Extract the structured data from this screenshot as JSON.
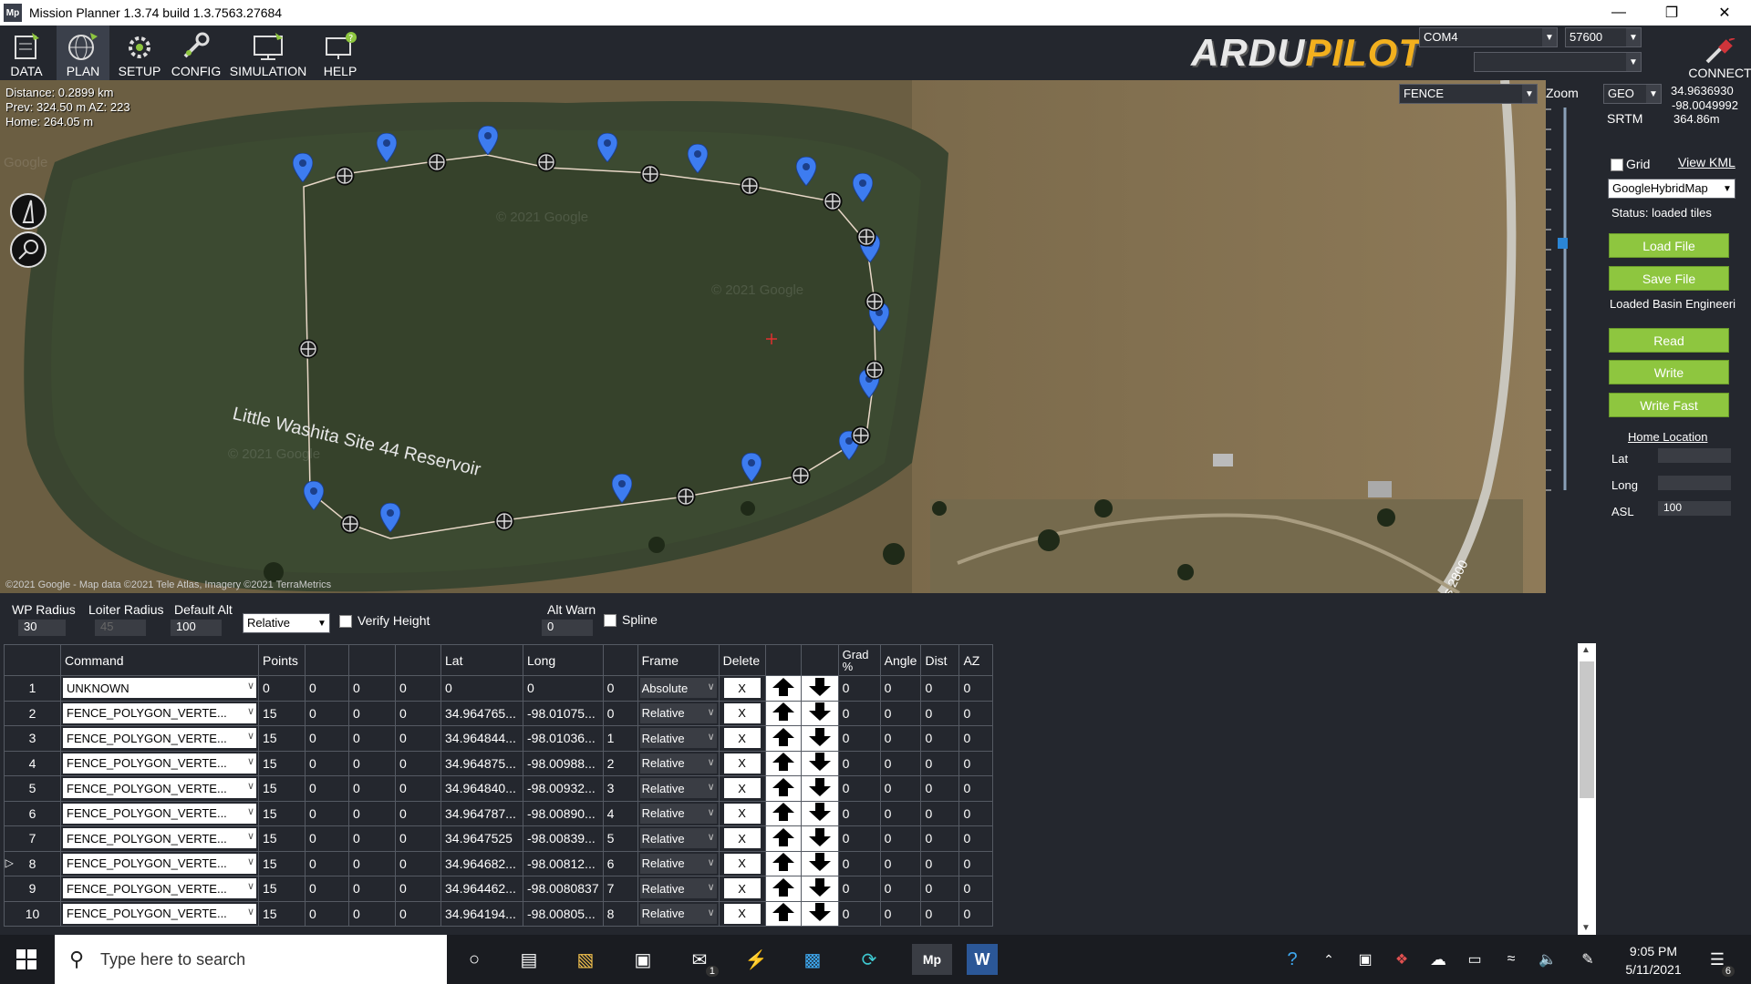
{
  "window": {
    "title": "Mission Planner 1.3.74 build 1.3.7563.27684",
    "icon_text": "Mp"
  },
  "toolbar": {
    "items": [
      {
        "label": "DATA",
        "icon": "data-icon"
      },
      {
        "label": "PLAN",
        "icon": "plan-globe-icon"
      },
      {
        "label": "SETUP",
        "icon": "setup-gear-icon"
      },
      {
        "label": "CONFIG",
        "icon": "config-tool-icon"
      },
      {
        "label": "SIMULATION",
        "icon": "simulation-monitor-icon"
      },
      {
        "label": "HELP",
        "icon": "help-monitor-icon"
      }
    ],
    "logo_a": "ARDU",
    "logo_b": "PILOT",
    "port": "COM4",
    "baud": "57600",
    "connect_label": "CONNECT"
  },
  "map": {
    "info": [
      "Distance: 0.2899 km",
      "Prev: 324.50 m AZ: 223",
      "Home: 264.05 m"
    ],
    "lake_label": "Little Washita Site 44 Reservoir",
    "road_label": "Cs 2800",
    "attribution": "©2021 Google - Map data ©2021 Tele Atlas, Imagery ©2021 TerraMetrics",
    "watermark": "© 2021 Google",
    "watermark_short": "Google",
    "mode": "FENCE"
  },
  "side": {
    "zoom_label": "Zoom",
    "coord_mode": "GEO",
    "lat": "34.9636930",
    "lng": "-98.0049992",
    "alt": "364.86m",
    "srtm": "SRTM",
    "grid_label": "Grid",
    "view_kml": "View KML",
    "map_type": "GoogleHybridMap",
    "status": "Status: loaded tiles",
    "load_file": "Load File",
    "save_file": "Save File",
    "loaded_text": "Loaded Basin Engineeri",
    "read": "Read",
    "write": "Write",
    "write_fast": "Write Fast",
    "home_location": "Home Location",
    "lat_label": "Lat",
    "long_label": "Long",
    "asl_label": "ASL",
    "asl_value": "100",
    "collapse": "v"
  },
  "controls": {
    "wp_radius_label": "WP Radius",
    "wp_radius": "30",
    "loiter_label": "Loiter Radius",
    "loiter": "45",
    "default_alt_label": "Default Alt",
    "default_alt": "100",
    "alt_frame": "Relative",
    "verify_height": "Verify Height",
    "alt_warn_label": "Alt Warn",
    "alt_warn": "0",
    "spline": "Spline"
  },
  "table": {
    "headers": [
      "",
      "Command",
      "Points",
      "",
      "",
      "",
      "Lat",
      "Long",
      "",
      "Frame",
      "Delete",
      "",
      "",
      "Grad %",
      "Angle",
      "Dist",
      "AZ"
    ],
    "rows": [
      [
        "1",
        "UNKNOWN",
        "0",
        "0",
        "0",
        "0",
        "0",
        "0",
        "0",
        "Absolute",
        "X",
        "0",
        "0",
        "0",
        "0"
      ],
      [
        "2",
        "FENCE_POLYGON_VERTE...",
        "15",
        "0",
        "0",
        "0",
        "34.964765...",
        "-98.01075...",
        "0",
        "Relative",
        "X",
        "0",
        "0",
        "0",
        "0"
      ],
      [
        "3",
        "FENCE_POLYGON_VERTE...",
        "15",
        "0",
        "0",
        "0",
        "34.964844...",
        "-98.01036...",
        "1",
        "Relative",
        "X",
        "0",
        "0",
        "0",
        "0"
      ],
      [
        "4",
        "FENCE_POLYGON_VERTE...",
        "15",
        "0",
        "0",
        "0",
        "34.964875...",
        "-98.00988...",
        "2",
        "Relative",
        "X",
        "0",
        "0",
        "0",
        "0"
      ],
      [
        "5",
        "FENCE_POLYGON_VERTE...",
        "15",
        "0",
        "0",
        "0",
        "34.964840...",
        "-98.00932...",
        "3",
        "Relative",
        "X",
        "0",
        "0",
        "0",
        "0"
      ],
      [
        "6",
        "FENCE_POLYGON_VERTE...",
        "15",
        "0",
        "0",
        "0",
        "34.964787...",
        "-98.00890...",
        "4",
        "Relative",
        "X",
        "0",
        "0",
        "0",
        "0"
      ],
      [
        "7",
        "FENCE_POLYGON_VERTE...",
        "15",
        "0",
        "0",
        "0",
        "34.9647525",
        "-98.00839...",
        "5",
        "Relative",
        "X",
        "0",
        "0",
        "0",
        "0"
      ],
      [
        "8",
        "FENCE_POLYGON_VERTE...",
        "15",
        "0",
        "0",
        "0",
        "34.964682...",
        "-98.00812...",
        "6",
        "Relative",
        "X",
        "0",
        "0",
        "0",
        "0"
      ],
      [
        "9",
        "FENCE_POLYGON_VERTE...",
        "15",
        "0",
        "0",
        "0",
        "34.964462...",
        "-98.0080837",
        "7",
        "Relative",
        "X",
        "0",
        "0",
        "0",
        "0"
      ],
      [
        "10",
        "FENCE_POLYGON_VERTE...",
        "15",
        "0",
        "0",
        "0",
        "34.964194...",
        "-98.00805...",
        "8",
        "Relative",
        "X",
        "0",
        "0",
        "0",
        "0"
      ]
    ],
    "selected_row": "8"
  },
  "taskbar": {
    "search_placeholder": "Type here to search",
    "time": "9:05 PM",
    "date": "5/11/2021",
    "mail_badge": "1",
    "notif_badge": "6"
  },
  "colors": {
    "accent_green": "#8ec63f",
    "waypoint_blue": "#3d7cf0",
    "toolbar": "#24272e"
  }
}
